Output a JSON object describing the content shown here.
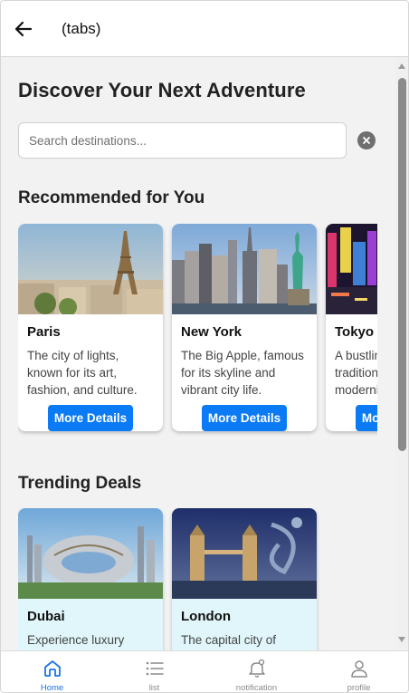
{
  "header": {
    "title": "(tabs)",
    "back_icon": "arrow-left-icon"
  },
  "main": {
    "title": "Discover Your Next Adventure",
    "search": {
      "placeholder": "Search destinations...",
      "value": "",
      "clear_icon": "close-circle-icon"
    }
  },
  "recommended": {
    "title": "Recommended for You",
    "button_label": "More Details",
    "items": [
      {
        "name": "Paris",
        "description": "The city of lights, known for its art, fashion, and culture."
      },
      {
        "name": "New York",
        "description": "The Big Apple, famous for its skyline and vibrant city life."
      },
      {
        "name": "Tokyo",
        "description": "A bustling city blending tradition with modernity."
      }
    ]
  },
  "trending": {
    "title": "Trending Deals",
    "items": [
      {
        "name": "Dubai",
        "description": "Experience luxury"
      },
      {
        "name": "London",
        "description": "The capital city of"
      }
    ]
  },
  "tabbar": {
    "active": "Home",
    "items": [
      {
        "label": "Home",
        "icon": "home-icon"
      },
      {
        "label": "list",
        "icon": "list-icon"
      },
      {
        "label": "notification",
        "icon": "bell-icon"
      },
      {
        "label": "profile",
        "icon": "person-icon"
      }
    ]
  },
  "colors": {
    "accent": "#0a7af5",
    "active_tab": "#1a73e8",
    "deal_card_bg": "#e0f6fa"
  }
}
